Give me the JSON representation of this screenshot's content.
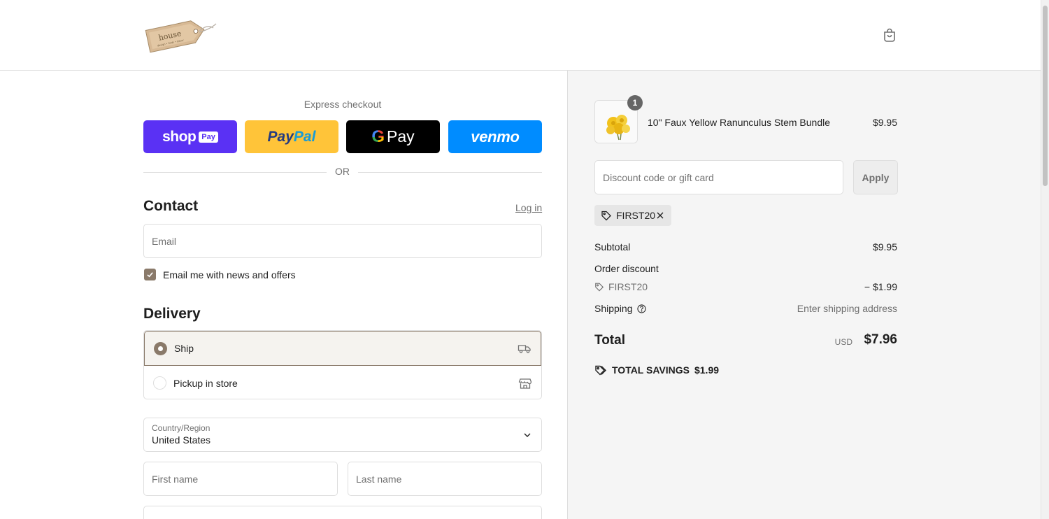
{
  "brand": {
    "logo_text": "house",
    "logo_subtext": "design • finds • decor"
  },
  "express": {
    "title": "Express checkout",
    "shop_label": "shop",
    "shop_pay_label": "Pay",
    "paypal_part1": "Pay",
    "paypal_part2": "Pal",
    "gpay_g": "G",
    "gpay_label": "Pay",
    "venmo_label": "venmo",
    "or_label": "OR"
  },
  "contact": {
    "heading": "Contact",
    "login_label": "Log in",
    "email_placeholder": "Email",
    "newsletter_label": "Email me with news and offers",
    "newsletter_checked": true
  },
  "delivery": {
    "heading": "Delivery",
    "options": [
      {
        "label": "Ship",
        "selected": true,
        "icon": "truck-icon"
      },
      {
        "label": "Pickup in store",
        "selected": false,
        "icon": "store-icon"
      }
    ],
    "country_label": "Country/Region",
    "country_value": "United States",
    "first_name_placeholder": "First name",
    "last_name_placeholder": "Last name"
  },
  "order": {
    "item": {
      "name": "10\" Faux Yellow Ranunculus Stem Bundle",
      "price": "$9.95",
      "quantity": "1"
    },
    "discount_placeholder": "Discount code or gift card",
    "apply_label": "Apply",
    "applied_code": "FIRST20",
    "subtotal_label": "Subtotal",
    "subtotal_value": "$9.95",
    "order_discount_label": "Order discount",
    "discount_code": "FIRST20",
    "discount_value": "− $1.99",
    "shipping_label": "Shipping",
    "shipping_value": "Enter shipping address",
    "total_label": "Total",
    "currency": "USD",
    "total_value": "$7.96",
    "savings_label": "TOTAL SAVINGS",
    "savings_value": "$1.99"
  },
  "colors": {
    "accent": "#8a7a6a",
    "shop_pay": "#5a31f4",
    "paypal": "#ffc439",
    "gpay": "#000000",
    "venmo": "#008cff"
  }
}
